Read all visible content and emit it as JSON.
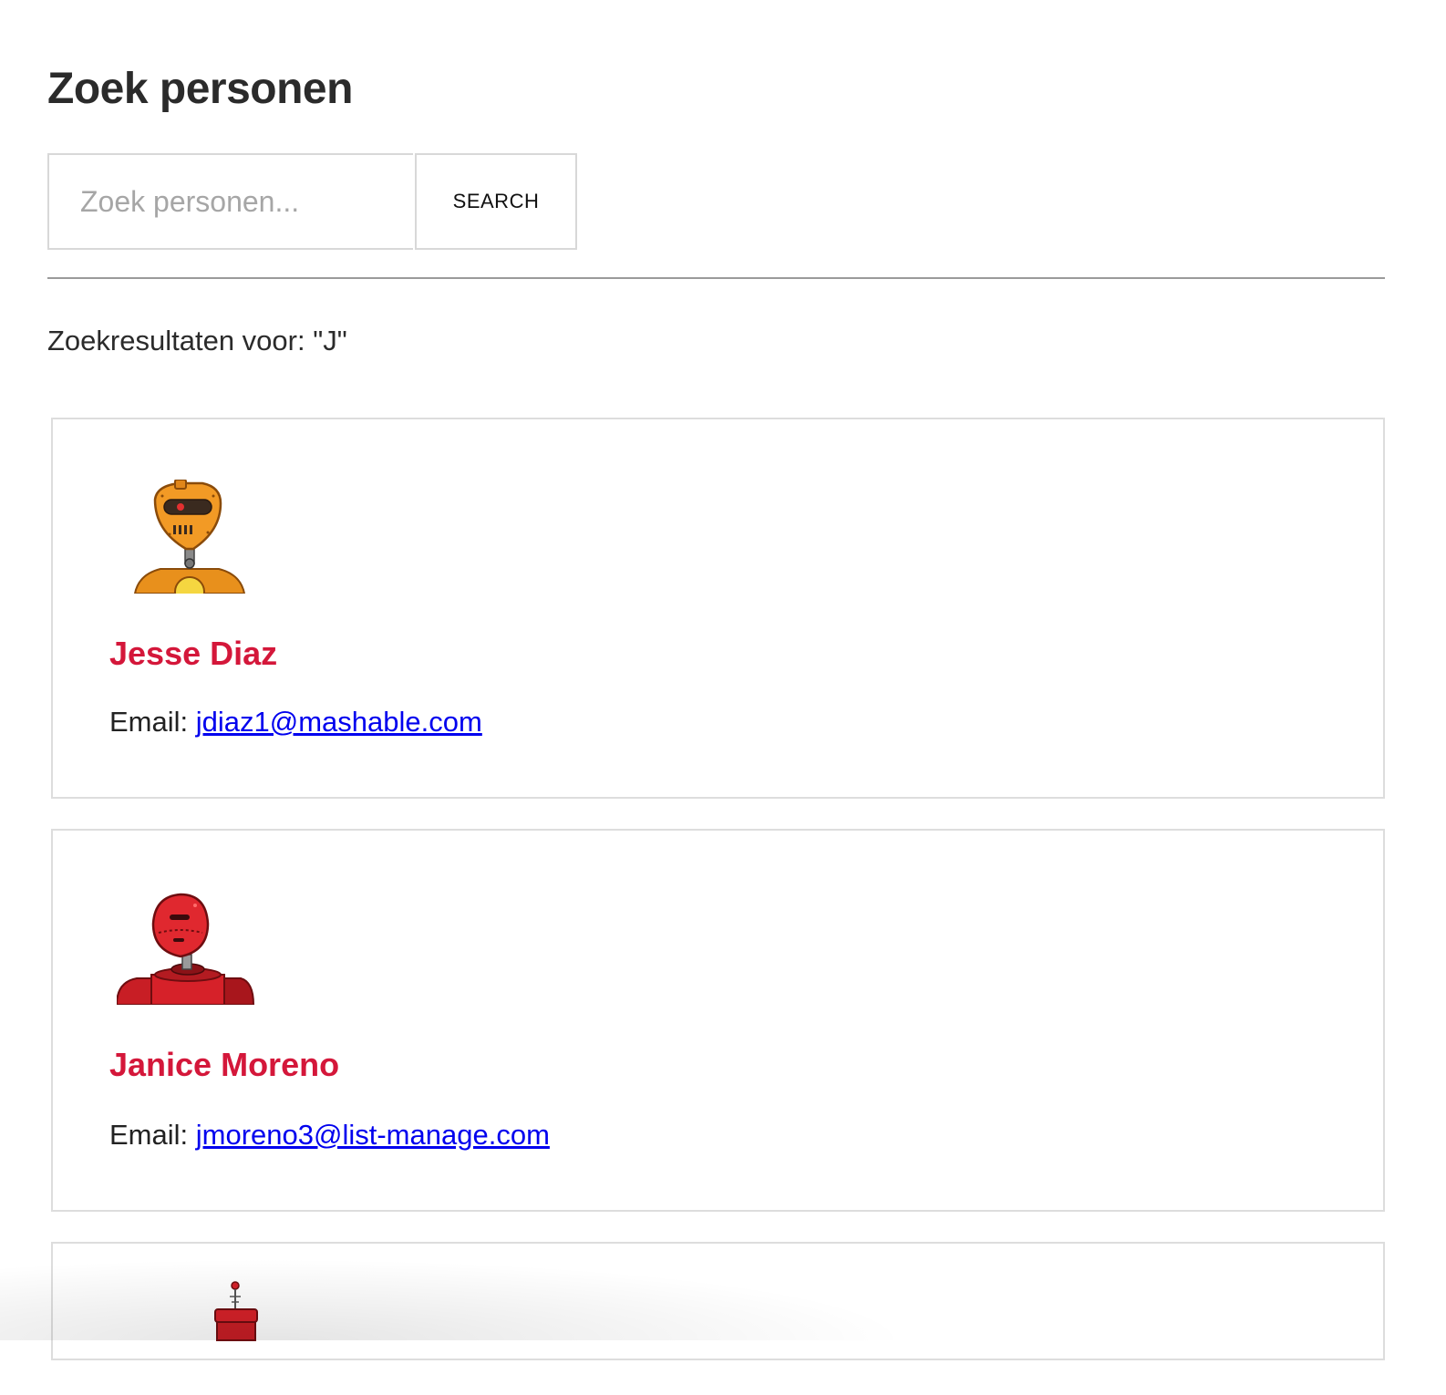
{
  "page": {
    "title": "Zoek personen"
  },
  "search": {
    "placeholder": "Zoek personen...",
    "value": "",
    "button_label": "SEARCH"
  },
  "results": {
    "heading": "Zoekresultaten voor: \"J\"",
    "email_label": "Email:",
    "people": [
      {
        "name": "Jesse Diaz",
        "email": "jdiaz1@mashable.com",
        "avatar_icon": "orange-robot-avatar-icon"
      },
      {
        "name": "Janice Moreno",
        "email": "jmoreno3@list-manage.com",
        "avatar_icon": "red-robot-avatar-icon"
      },
      {
        "name": "",
        "email": "",
        "avatar_icon": "red-antenna-robot-avatar-icon"
      }
    ]
  },
  "colors": {
    "name_accent": "#d4173a",
    "link": "#0000ee",
    "border": "#dddddd",
    "divider": "#9a9a9a"
  }
}
